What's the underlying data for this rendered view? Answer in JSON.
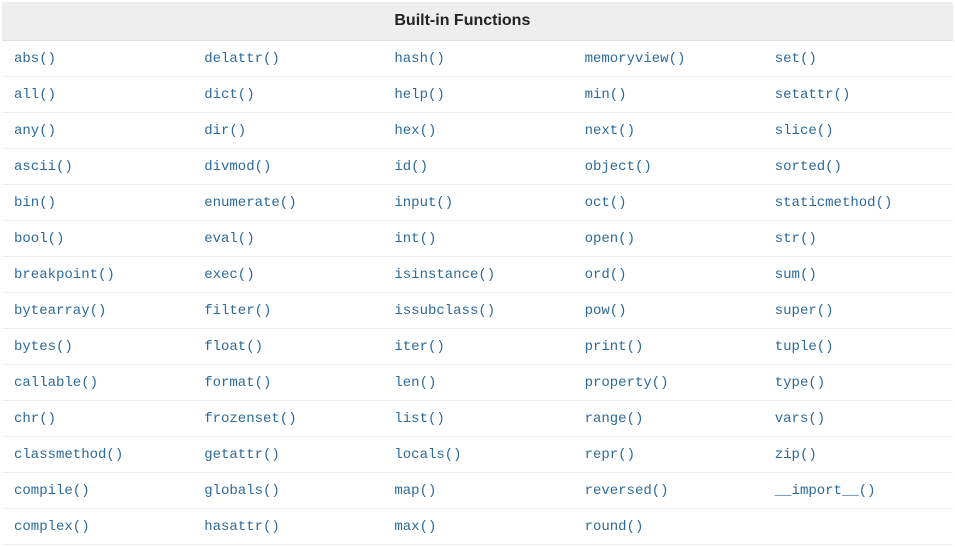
{
  "header": {
    "title": "Built-in Functions"
  },
  "table": {
    "columns": [
      [
        "abs()",
        "all()",
        "any()",
        "ascii()",
        "bin()",
        "bool()",
        "breakpoint()",
        "bytearray()",
        "bytes()",
        "callable()",
        "chr()",
        "classmethod()",
        "compile()",
        "complex()"
      ],
      [
        "delattr()",
        "dict()",
        "dir()",
        "divmod()",
        "enumerate()",
        "eval()",
        "exec()",
        "filter()",
        "float()",
        "format()",
        "frozenset()",
        "getattr()",
        "globals()",
        "hasattr()"
      ],
      [
        "hash()",
        "help()",
        "hex()",
        "id()",
        "input()",
        "int()",
        "isinstance()",
        "issubclass()",
        "iter()",
        "len()",
        "list()",
        "locals()",
        "map()",
        "max()"
      ],
      [
        "memoryview()",
        "min()",
        "next()",
        "object()",
        "oct()",
        "open()",
        "ord()",
        "pow()",
        "print()",
        "property()",
        "range()",
        "repr()",
        "reversed()",
        "round()"
      ],
      [
        "set()",
        "setattr()",
        "slice()",
        "sorted()",
        "staticmethod()",
        "str()",
        "sum()",
        "super()",
        "tuple()",
        "type()",
        "vars()",
        "zip()",
        "__import__()",
        ""
      ]
    ]
  }
}
